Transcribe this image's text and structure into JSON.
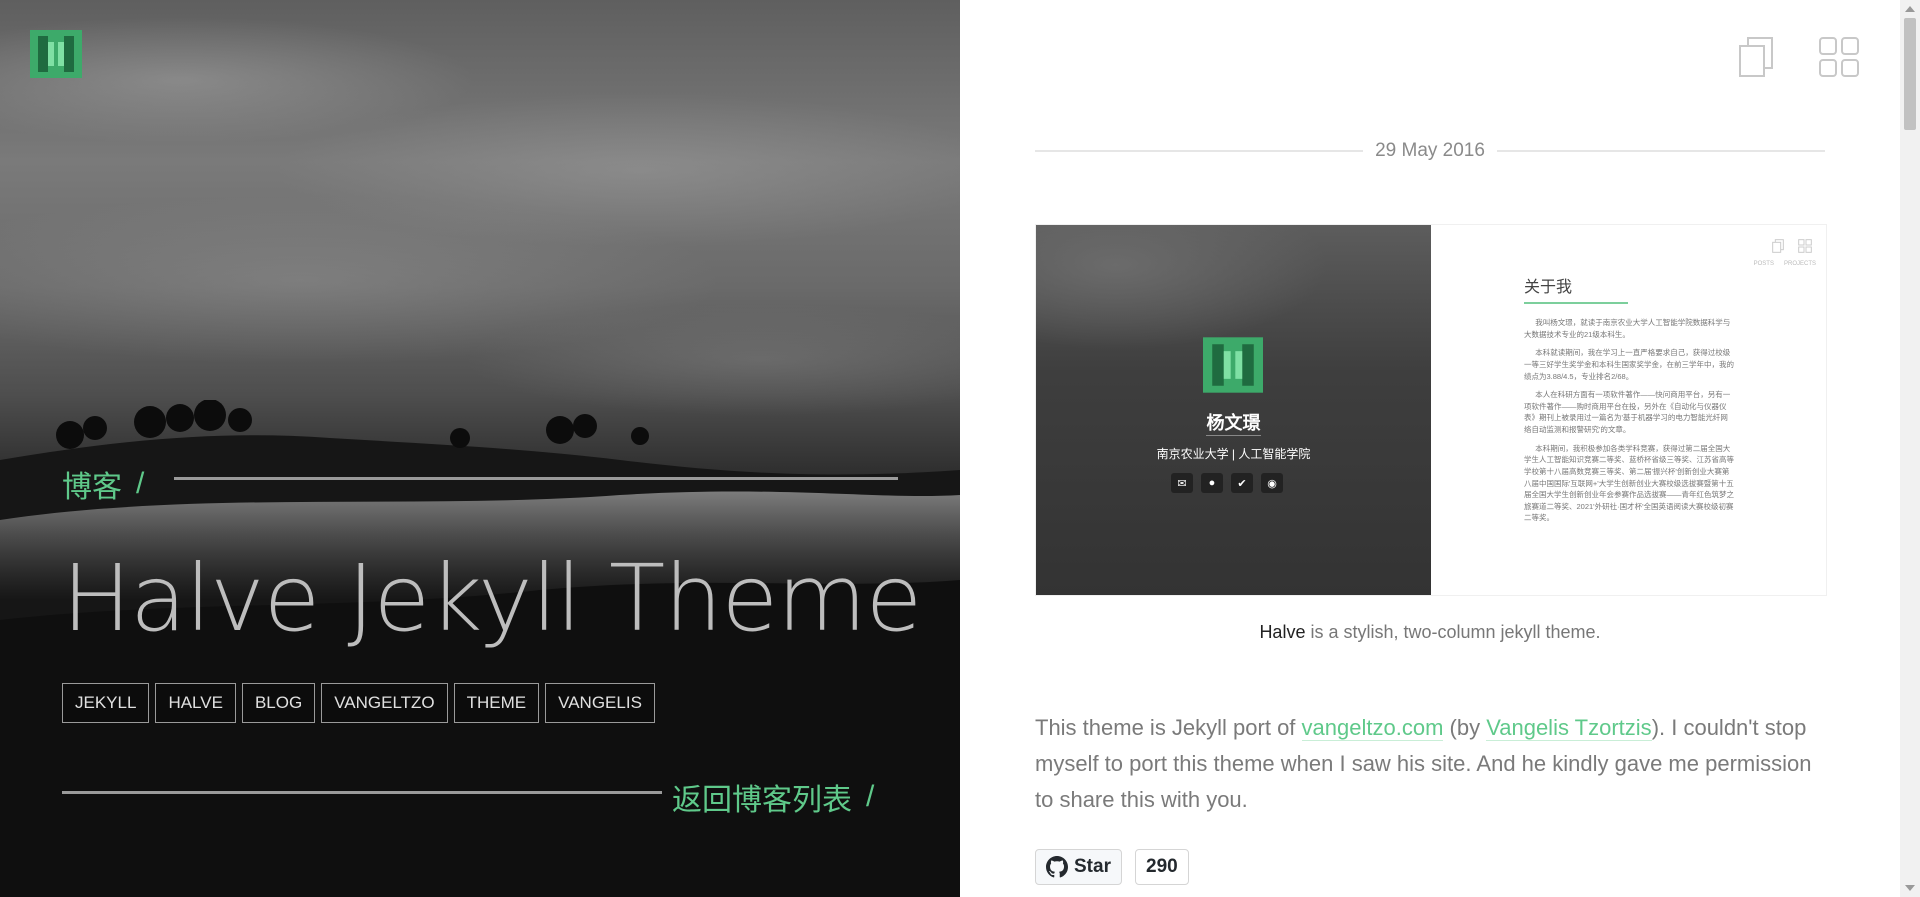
{
  "hero": {
    "blog_link": "博客",
    "slash": "/",
    "title": "Halve Jekyll Theme",
    "tags": [
      "JEKYLL",
      "HALVE",
      "BLOG",
      "VANGELTZO",
      "THEME",
      "VANGELIS"
    ],
    "back_link": "返回博客列表",
    "back_slash": "/"
  },
  "post": {
    "date": "29 May 2016",
    "preview": {
      "name": "杨文璟",
      "school": "南京农业大学 | 人工智能学院",
      "about_title": "关于我",
      "nav_labels": [
        "POSTS",
        "PROJECTS"
      ],
      "paragraphs": [
        "我叫杨文璟，就读于南京农业大学人工智能学院数据科学与大数据技术专业的21级本科生。",
        "本科就读期间，我在学习上一直严格要求自己，获得过校级一等三好学生奖学金和本科生国家奖学金，在前三学年中，我的绩点为3.88/4.5，专业排名2/68。",
        "本人在科研方面有一项软件著作——快问商用平台，另有一项软件著作——购时商用平台在投，另外在《自动化与仪器仪表》期刊上被录用过一篇名为'基于机器学习的电力智能光纤网络自动监测和报警研究'的文章。",
        "本科期间，我积极参加各类学科竞赛，获得过第二届全国大学生人工智能知识竞赛二等奖、蓝桥杯省级三等奖、江苏省高等学校第十八届高数竞赛三等奖、第二届'振兴杯'创新创业大赛第八届中国国际'互联网+'大学生创新创业大赛校级选拔赛暨第十五届全国大学生创新创业年会参赛作品选拔赛——青年红色筑梦之旅赛道二等奖、2021'外研社·国才杯'全国英语阅读大赛校级初赛二等奖。"
      ]
    },
    "caption_bold": "Halve",
    "caption_rest": " is a stylish, two-column jekyll theme.",
    "body": {
      "t1": "This theme is Jekyll port of ",
      "link1": "vangeltzo.com",
      "t2": " (by ",
      "link2": "Vangelis Tzortzis",
      "t3": "). I couldn't stop myself to port this theme when I saw his site. And he kindly gave me permission to share this with you."
    },
    "github": {
      "label": "Star",
      "count": "290"
    }
  },
  "colors": {
    "accent": "#5fc98a",
    "logo_green": "#3daa6a"
  }
}
